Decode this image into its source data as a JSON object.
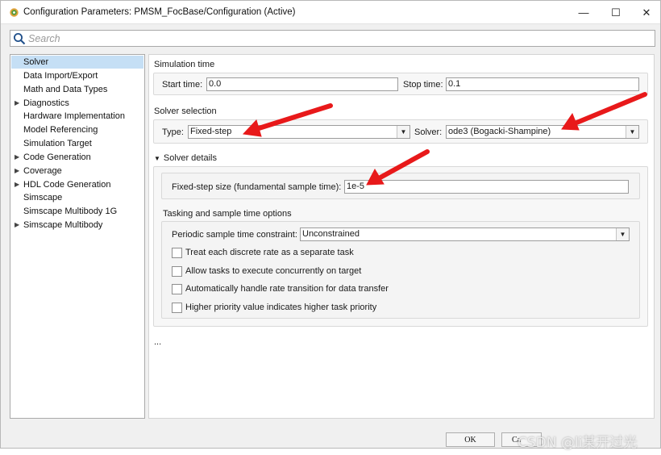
{
  "window": {
    "title": "Configuration Parameters: PMSM_FocBase/Configuration (Active)",
    "app_icon": "gear-icon",
    "controls": {
      "minimize": "—",
      "maximize": "☐",
      "close": "✕"
    }
  },
  "search": {
    "placeholder": "Search",
    "value": ""
  },
  "sidebar": {
    "items": [
      {
        "label": "Solver",
        "expandable": false,
        "selected": true
      },
      {
        "label": "Data Import/Export",
        "expandable": false
      },
      {
        "label": "Math and Data Types",
        "expandable": false
      },
      {
        "label": "Diagnostics",
        "expandable": true
      },
      {
        "label": "Hardware Implementation",
        "expandable": false
      },
      {
        "label": "Model Referencing",
        "expandable": false
      },
      {
        "label": "Simulation Target",
        "expandable": false
      },
      {
        "label": "Code Generation",
        "expandable": true
      },
      {
        "label": "Coverage",
        "expandable": true
      },
      {
        "label": "HDL Code Generation",
        "expandable": true
      },
      {
        "label": "Simscape",
        "expandable": false
      },
      {
        "label": "Simscape Multibody 1G",
        "expandable": false
      },
      {
        "label": "Simscape Multibody",
        "expandable": true
      }
    ]
  },
  "solver_pane": {
    "simulation_time": {
      "heading": "Simulation time",
      "start_label": "Start time:",
      "start_value": "0.0",
      "stop_label": "Stop time:",
      "stop_value": "0.1"
    },
    "solver_selection": {
      "heading": "Solver selection",
      "type_label": "Type:",
      "type_value": "Fixed-step",
      "solver_label": "Solver:",
      "solver_value": "ode3 (Bogacki-Shampine)"
    },
    "solver_details": {
      "heading": "Solver details",
      "expanded": true,
      "step_size_label": "Fixed-step size (fundamental sample time):",
      "step_size_value": "1e-5"
    },
    "tasking": {
      "heading": "Tasking and sample time options",
      "constraint_label": "Periodic sample time constraint:",
      "constraint_value": "Unconstrained",
      "checkboxes": [
        {
          "label": "Treat each discrete rate as a separate task",
          "checked": false
        },
        {
          "label": "Allow tasks to execute concurrently on target",
          "checked": false
        },
        {
          "label": "Automatically handle rate transition for data transfer",
          "checked": false
        },
        {
          "label": "Higher priority value indicates higher task priority",
          "checked": false
        }
      ]
    },
    "ellipsis": "..."
  },
  "buttons": {
    "ok": "OK",
    "cancel": "Ca"
  },
  "watermark": "CSDN @li某开过光",
  "colors": {
    "annotation_arrow": "#e8191a",
    "selection": "#c5dff5"
  }
}
